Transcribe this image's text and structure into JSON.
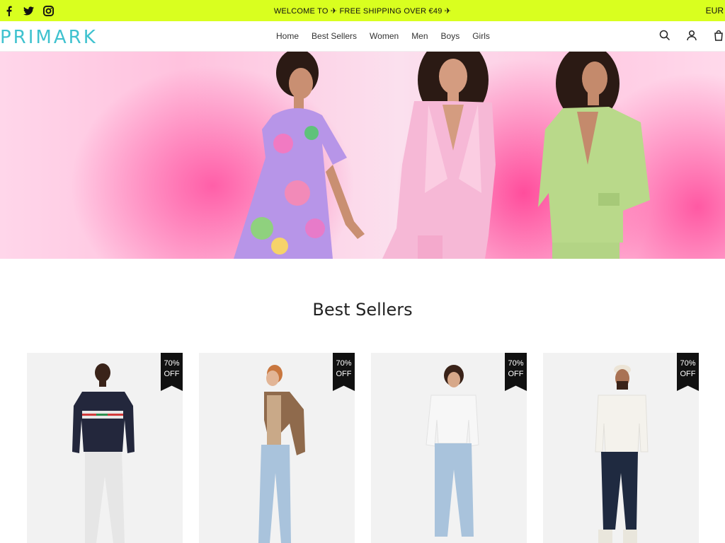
{
  "announcement": {
    "text": "WELCOME TO  ✈ FREE SHIPPING OVER €49 ✈",
    "currency": "EUR",
    "social_icons": [
      "facebook-icon",
      "twitter-icon",
      "instagram-icon"
    ]
  },
  "header": {
    "logo": "PRIMARK",
    "nav": [
      "Home",
      "Best Sellers",
      "Women",
      "Men",
      "Boys",
      "Girls"
    ],
    "icons": [
      "search-icon",
      "account-icon",
      "bag-icon"
    ]
  },
  "colors": {
    "accent_bar": "#d9ff1f",
    "logo": "#3fc2cf",
    "badge": "#111111"
  },
  "section": {
    "title": "Best Sellers"
  },
  "products": [
    {
      "badge_pct": "70%",
      "badge_label": "OFF"
    },
    {
      "badge_pct": "70%",
      "badge_label": "OFF"
    },
    {
      "badge_pct": "70%",
      "badge_label": "OFF"
    },
    {
      "badge_pct": "70%",
      "badge_label": "OFF"
    }
  ]
}
